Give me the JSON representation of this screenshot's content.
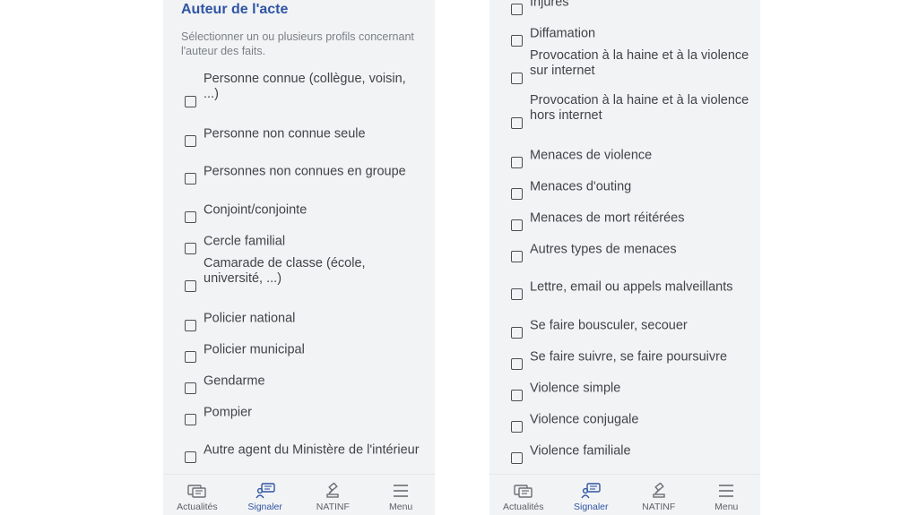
{
  "left": {
    "heading": "Auteur de l'acte",
    "description": "Sélectionner un ou plusieurs profils concernant l'auteur des faits.",
    "options": [
      "Personne connue (collègue, voisin, ...)",
      "Personne non connue seule",
      "Personnes non connues en groupe",
      "Conjoint/conjointe",
      "Cercle familial",
      "Camarade de classe (école, université, ...)",
      "Policier national",
      "Policier municipal",
      "Gendarme",
      "Pompier",
      "Autre agent du Ministère de l'intérieur"
    ]
  },
  "right": {
    "options": [
      "Injures",
      "Diffamation",
      "Provocation à la haine et à la violence sur internet",
      "Provocation à la haine et à la violence hors internet",
      "Menaces de violence",
      "Menaces d'outing",
      "Menaces de mort réitérées",
      "Autres types de menaces",
      "Lettre, email ou appels malveillants",
      "Se faire bousculer, secouer",
      "Se faire suivre, se faire poursuivre",
      "Violence simple",
      "Violence conjugale",
      "Violence familiale"
    ]
  },
  "nav": {
    "items": [
      "Actualités",
      "Signaler",
      "NATINF",
      "Menu"
    ],
    "active": "Signaler",
    "icons": [
      "news-icon",
      "report-chat-icon",
      "gavel-icon",
      "hamburger-menu-icon"
    ],
    "accent_color": "#2f55a4"
  }
}
